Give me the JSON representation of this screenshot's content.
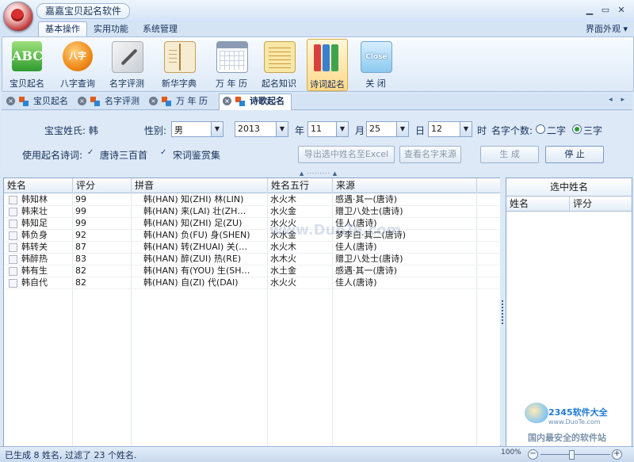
{
  "window": {
    "title": "嘉嘉宝贝起名软件",
    "minimize": "▁",
    "restore": "▭",
    "close": "✕"
  },
  "ribbon": {
    "tabs": [
      {
        "label": "基本操作",
        "active": true
      },
      {
        "label": "实用功能",
        "active": false
      },
      {
        "label": "系统管理",
        "active": false
      }
    ],
    "skin_menu": "界面外观 ▾",
    "buttons": [
      {
        "label": "宝贝起名",
        "icon": "abc-icon",
        "icon_text": "ABC"
      },
      {
        "label": "八字查询",
        "icon": "bazi-icon",
        "icon_text": "八字"
      },
      {
        "label": "名字评测",
        "icon": "pen-icon",
        "icon_text": ""
      },
      {
        "label": "新华字典",
        "icon": "dictionary-icon",
        "icon_text": ""
      },
      {
        "label": "万 年 历",
        "icon": "calendar-icon",
        "icon_text": ""
      },
      {
        "label": "起名知识",
        "icon": "notepad-icon",
        "icon_text": ""
      },
      {
        "label": "诗词起名",
        "icon": "binders-icon",
        "icon_text": ""
      },
      {
        "label": "关  闭",
        "icon": "close-icon",
        "icon_text": "Close"
      }
    ]
  },
  "doc_tabs": [
    {
      "label": "宝贝起名",
      "active": false
    },
    {
      "label": "名字评测",
      "active": false
    },
    {
      "label": "万 年 历",
      "active": false
    },
    {
      "label": "诗歌起名",
      "active": true
    }
  ],
  "tab_scroll": "◂ ▸",
  "form": {
    "surname_label": "宝宝姓氏: 韩",
    "gender_label": "性别:",
    "gender_value": "男",
    "year_value": "2013",
    "year_label": "年",
    "month_value": "11",
    "month_label": "月",
    "day_value": "25",
    "day_label": "日",
    "hour_value": "12",
    "hour_label": "时",
    "name_count_label": "名字个数:",
    "radio_two": "二字",
    "radio_three": "三字",
    "poem_label": "使用起名诗词:",
    "poem_tang": "唐诗三百首",
    "poem_song": "宋词鉴赏集",
    "export_button": "导出选中姓名至Excel",
    "source_button": "查看名字来源",
    "generate_button": "生  成",
    "stop_button": "停 止"
  },
  "table": {
    "headers": [
      "姓名",
      "评分",
      "拼音",
      "姓名五行",
      "来源"
    ],
    "rows": [
      {
        "name": "韩知林",
        "score": "99",
        "pinyin": "韩(HAN)  知(ZHI)  林(LIN)",
        "wuxing": "水火木",
        "source": "感遇·其一(唐诗)"
      },
      {
        "name": "韩来壮",
        "score": "99",
        "pinyin": "韩(HAN)  来(LAI)  壮(ZH…",
        "wuxing": "水火金",
        "source": "赠卫八处士(唐诗)"
      },
      {
        "name": "韩知足",
        "score": "99",
        "pinyin": "韩(HAN)  知(ZHI)  足(ZU)",
        "wuxing": "水火火",
        "source": "佳人(唐诗)"
      },
      {
        "name": "韩负身",
        "score": "92",
        "pinyin": "韩(HAN)  负(FU)  身(SHEN)",
        "wuxing": "水水金",
        "source": "梦李白·其二(唐诗)"
      },
      {
        "name": "韩转关",
        "score": "87",
        "pinyin": "韩(HAN)  转(ZHUAI)  关(…",
        "wuxing": "水火木",
        "source": "佳人(唐诗)"
      },
      {
        "name": "韩醉热",
        "score": "83",
        "pinyin": "韩(HAN)  醉(ZUI)  热(RE)",
        "wuxing": "水木火",
        "source": "赠卫八处士(唐诗)"
      },
      {
        "name": "韩有生",
        "score": "82",
        "pinyin": "韩(HAN)  有(YOU)  生(SH…",
        "wuxing": "水土金",
        "source": "感遇·其一(唐诗)"
      },
      {
        "name": "韩自代",
        "score": "82",
        "pinyin": "韩(HAN)  自(ZI)  代(DAI)",
        "wuxing": "水火火",
        "source": "佳人(唐诗)"
      }
    ]
  },
  "selected_panel": {
    "title": "选中姓名",
    "headers": [
      "姓名",
      "评分"
    ]
  },
  "watermark": {
    "center": "www.DuoTe.com",
    "brand": "2345软件大全",
    "url": "www.DuoTe.com",
    "slogan": "国内最安全的软件站"
  },
  "status": {
    "text": "已生成 8 姓名, 过滤了 23 个姓名.",
    "zoom": "100%"
  },
  "colors": {
    "accent_blue": "#15305a",
    "selected_radio": "#2e9a2e"
  }
}
